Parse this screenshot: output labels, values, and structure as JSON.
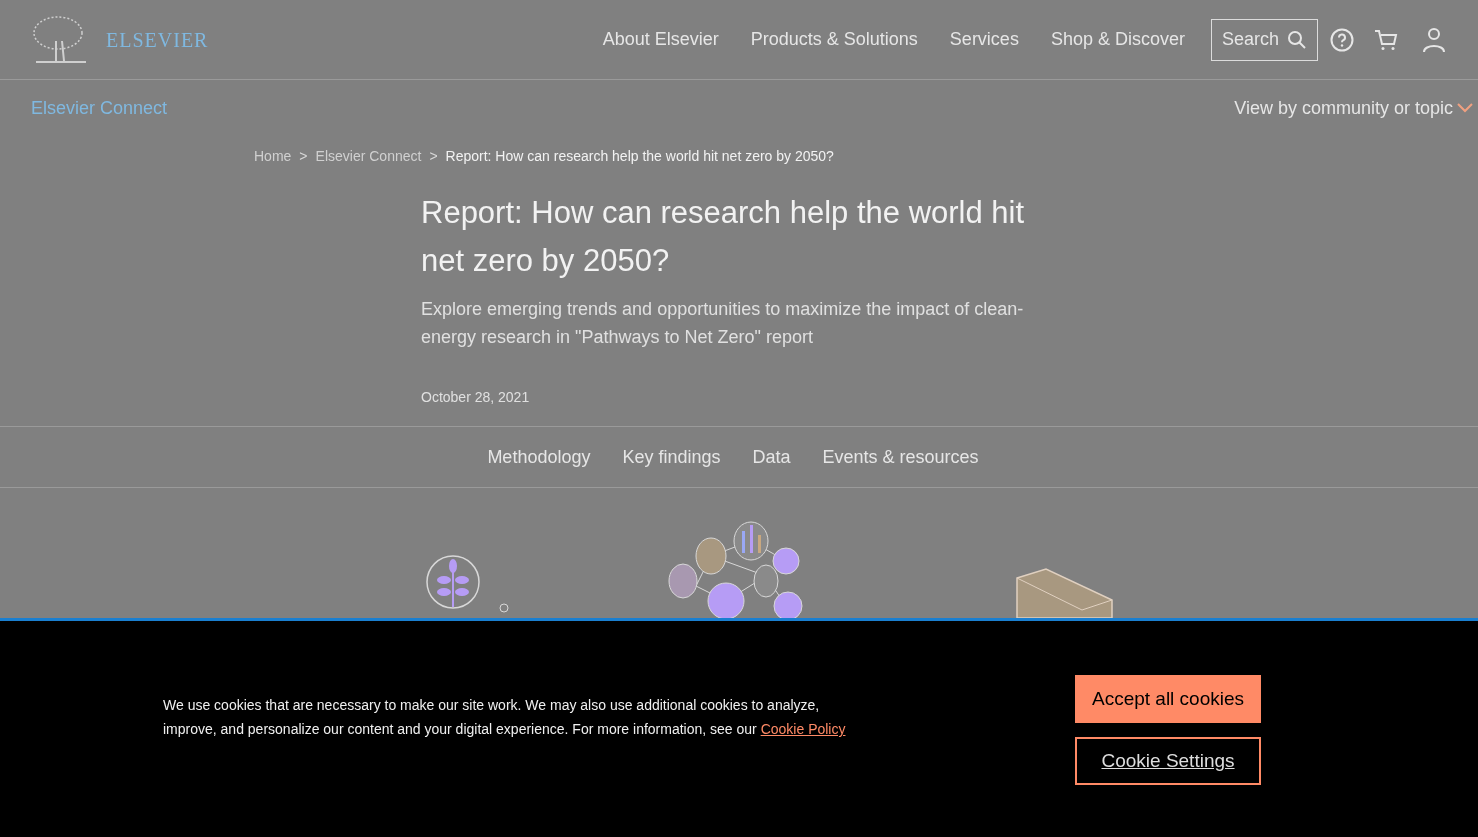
{
  "header": {
    "brand": "ELSEVIER",
    "nav": [
      "About Elsevier",
      "Products & Solutions",
      "Services",
      "Shop & Discover"
    ],
    "search": {
      "label": "Search"
    }
  },
  "subnav": {
    "title": "Elsevier Connect",
    "topic_menu": "View by community or topic"
  },
  "breadcrumb": [
    {
      "label": "Home"
    },
    {
      "separator": ">",
      "label": "Elsevier Connect"
    },
    {
      "separator": ">",
      "label": "Report: How can research help the world hit net zero by 2050?"
    }
  ],
  "article": {
    "title": "Report: How can research help the world hit net zero by 2050?",
    "subtitle": "Explore emerging trends and opportunities to maximize the impact of clean-energy research in \"Pathways to Net Zero\" report",
    "date": "October 28, 2021"
  },
  "section_tabs": [
    "Methodology",
    "Key findings",
    "Data",
    "Events & resources"
  ],
  "cookie_banner": {
    "text": "We use cookies that are necessary to make our site work. We may also use additional cookies to analyze, improve, and personalize our content and your digital experience. For more information, see our",
    "link": "Cookie Policy",
    "buttons": [
      {
        "label": "Accept all cookies",
        "kind": "primary"
      },
      {
        "label": "Cookie Settings",
        "kind": "outline"
      }
    ]
  }
}
